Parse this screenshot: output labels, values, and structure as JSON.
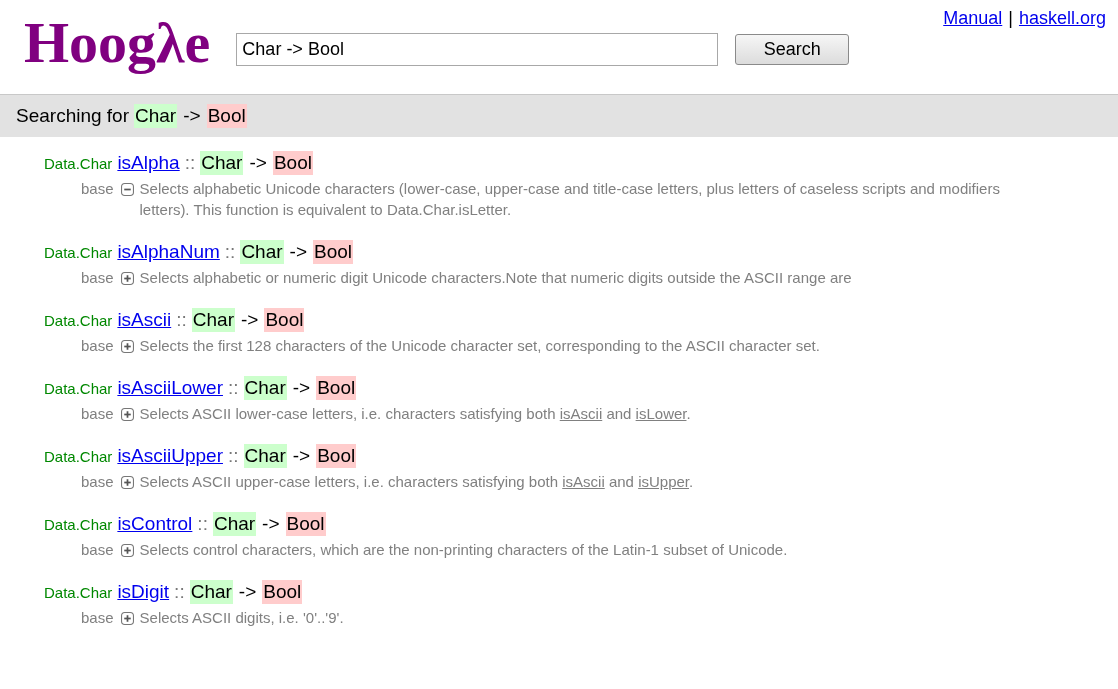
{
  "logo": "Hoogλe",
  "search": {
    "value": "Char -> Bool",
    "button": "Search"
  },
  "top_links": [
    {
      "label": "Manual"
    },
    {
      "label": "haskell.org"
    }
  ],
  "top_links_separator": "|",
  "query_bar": {
    "prefix": "Searching for",
    "tokens": [
      {
        "kind": "arg",
        "text": "Char"
      },
      {
        "kind": "arrow",
        "text": "->"
      },
      {
        "kind": "result",
        "text": "Bool"
      }
    ]
  },
  "results": [
    {
      "module": "Data.Char",
      "name": "isAlpha",
      "separator": "::",
      "signature": [
        {
          "kind": "arg",
          "text": "Char"
        },
        {
          "kind": "arrow",
          "text": "->"
        },
        {
          "kind": "result",
          "text": "Bool"
        }
      ],
      "package": "base",
      "expanded": true,
      "description": [
        {
          "kind": "text",
          "text": "Selects alphabetic Unicode characters (lower-case, upper-case and title-case letters, plus letters of caseless scripts and modifiers letters). This function is equivalent to Data.Char.isLetter."
        }
      ]
    },
    {
      "module": "Data.Char",
      "name": "isAlphaNum",
      "separator": "::",
      "signature": [
        {
          "kind": "arg",
          "text": "Char"
        },
        {
          "kind": "arrow",
          "text": "->"
        },
        {
          "kind": "result",
          "text": "Bool"
        }
      ],
      "package": "base",
      "expanded": false,
      "description": [
        {
          "kind": "text",
          "text": "Selects alphabetic or numeric digit Unicode characters.Note that numeric digits outside the ASCII range are"
        }
      ]
    },
    {
      "module": "Data.Char",
      "name": "isAscii",
      "separator": "::",
      "signature": [
        {
          "kind": "arg",
          "text": "Char"
        },
        {
          "kind": "arrow",
          "text": "->"
        },
        {
          "kind": "result",
          "text": "Bool"
        }
      ],
      "package": "base",
      "expanded": false,
      "description": [
        {
          "kind": "text",
          "text": "Selects the first 128 characters of the Unicode character set, corresponding to the ASCII character set."
        }
      ]
    },
    {
      "module": "Data.Char",
      "name": "isAsciiLower",
      "separator": "::",
      "signature": [
        {
          "kind": "arg",
          "text": "Char"
        },
        {
          "kind": "arrow",
          "text": "->"
        },
        {
          "kind": "result",
          "text": "Bool"
        }
      ],
      "package": "base",
      "expanded": false,
      "description": [
        {
          "kind": "text",
          "text": "Selects ASCII lower-case letters, i.e. characters satisfying both "
        },
        {
          "kind": "link",
          "text": "isAscii"
        },
        {
          "kind": "text",
          "text": " and "
        },
        {
          "kind": "link",
          "text": "isLower"
        },
        {
          "kind": "text",
          "text": "."
        }
      ]
    },
    {
      "module": "Data.Char",
      "name": "isAsciiUpper",
      "separator": "::",
      "signature": [
        {
          "kind": "arg",
          "text": "Char"
        },
        {
          "kind": "arrow",
          "text": "->"
        },
        {
          "kind": "result",
          "text": "Bool"
        }
      ],
      "package": "base",
      "expanded": false,
      "description": [
        {
          "kind": "text",
          "text": "Selects ASCII upper-case letters, i.e. characters satisfying both "
        },
        {
          "kind": "link",
          "text": "isAscii"
        },
        {
          "kind": "text",
          "text": " and "
        },
        {
          "kind": "link",
          "text": "isUpper"
        },
        {
          "kind": "text",
          "text": "."
        }
      ]
    },
    {
      "module": "Data.Char",
      "name": "isControl",
      "separator": "::",
      "signature": [
        {
          "kind": "arg",
          "text": "Char"
        },
        {
          "kind": "arrow",
          "text": "->"
        },
        {
          "kind": "result",
          "text": "Bool"
        }
      ],
      "package": "base",
      "expanded": false,
      "description": [
        {
          "kind": "text",
          "text": "Selects control characters, which are the non-printing characters of the Latin-1 subset of Unicode."
        }
      ]
    },
    {
      "module": "Data.Char",
      "name": "isDigit",
      "separator": "::",
      "signature": [
        {
          "kind": "arg",
          "text": "Char"
        },
        {
          "kind": "arrow",
          "text": "->"
        },
        {
          "kind": "result",
          "text": "Bool"
        }
      ],
      "package": "base",
      "expanded": false,
      "description": [
        {
          "kind": "text",
          "text": "Selects ASCII digits, i.e. '0'..'9'."
        }
      ]
    }
  ]
}
